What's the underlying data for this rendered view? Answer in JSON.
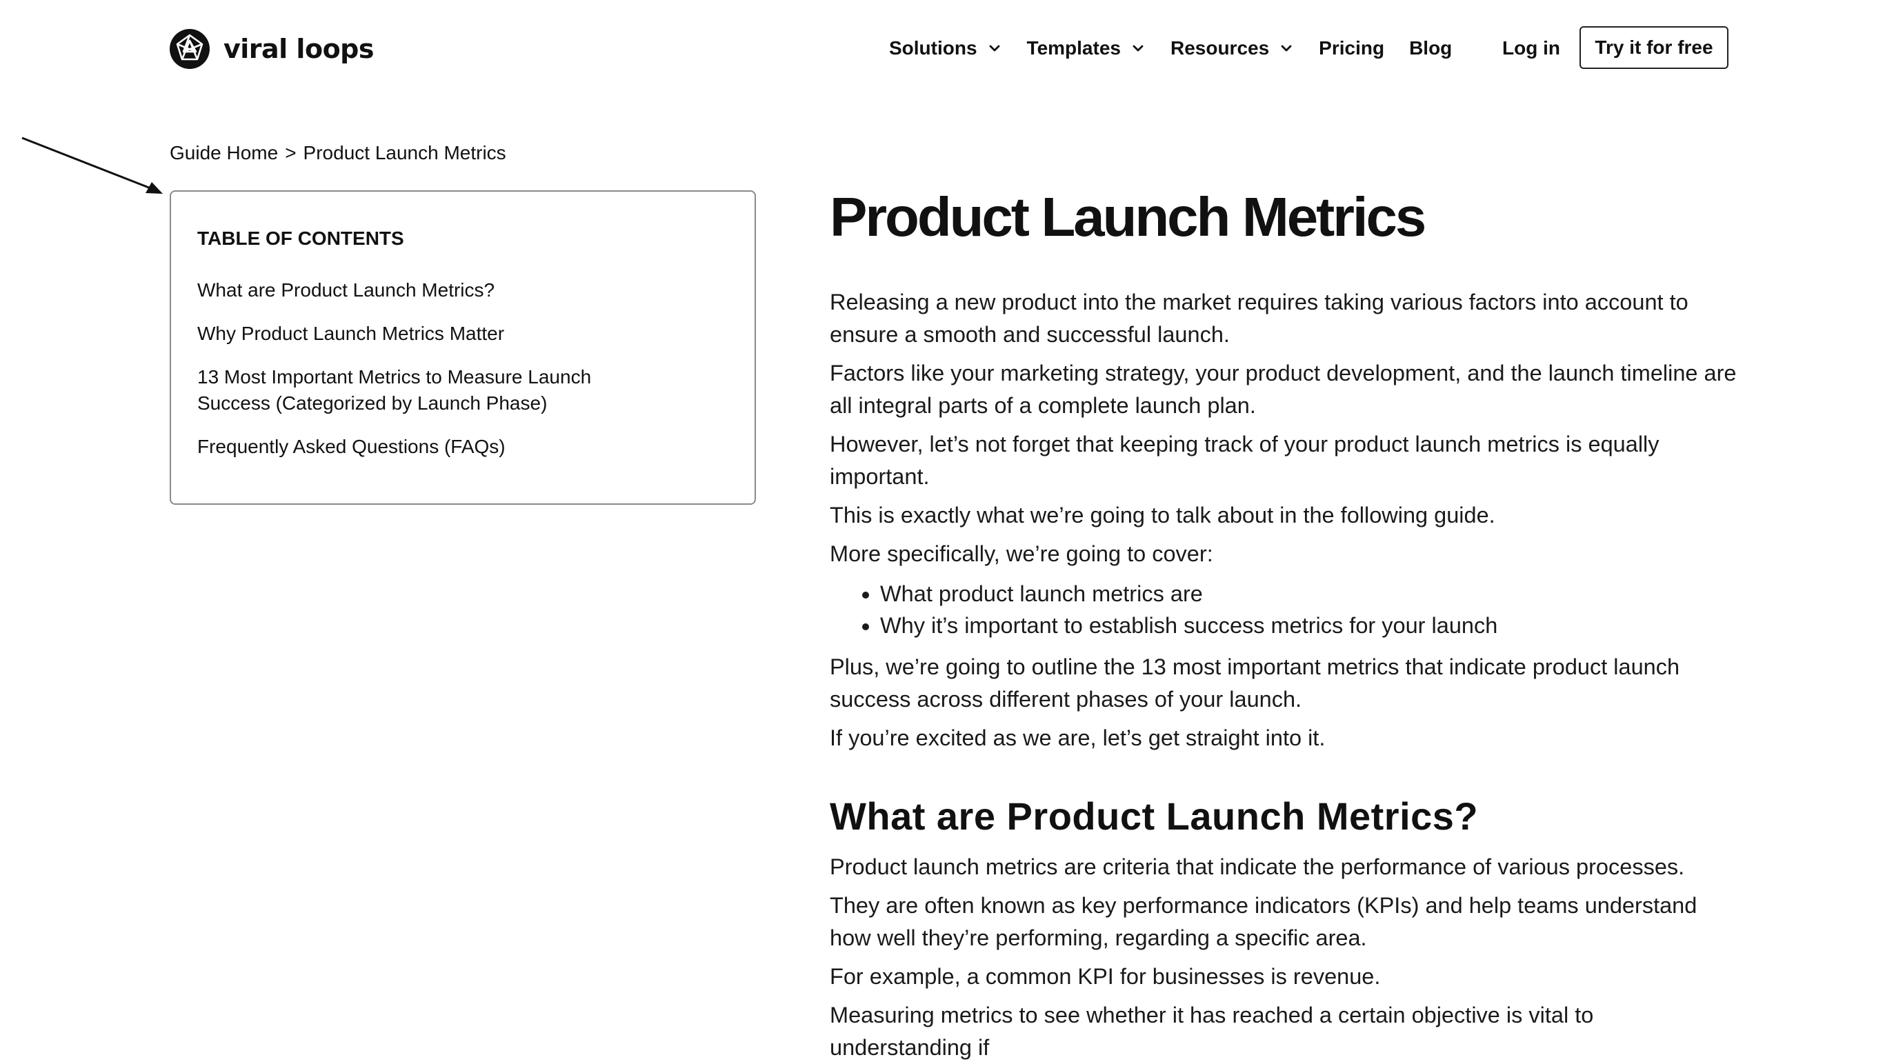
{
  "brand": {
    "name": "viral loops"
  },
  "nav": {
    "items": [
      {
        "label": "Solutions",
        "dropdown": true
      },
      {
        "label": "Templates",
        "dropdown": true
      },
      {
        "label": "Resources",
        "dropdown": true
      },
      {
        "label": "Pricing",
        "dropdown": false
      },
      {
        "label": "Blog",
        "dropdown": false
      }
    ],
    "login": "Log in",
    "cta": "Try it for free"
  },
  "breadcrumb": {
    "home": "Guide Home",
    "separator": ">",
    "current": "Product Launch Metrics"
  },
  "toc": {
    "title": "TABLE OF CONTENTS",
    "items": [
      "What are Product Launch Metrics?",
      "Why Product Launch Metrics Matter",
      "13 Most Important Metrics to Measure Launch Success (Categorized by Launch Phase)",
      "Frequently Asked Questions (FAQs)"
    ]
  },
  "article": {
    "title": "Product Launch Metrics",
    "intro": [
      "Releasing a new product into the market requires taking various factors into account to ensure a smooth and successful launch.",
      "Factors like your marketing strategy, your product development, and the launch timeline are all integral parts of a complete launch plan.",
      "However, let’s not forget that keeping track of your product launch metrics is equally important.",
      "This is exactly what we’re going to talk about in the following guide.",
      "More specifically, we’re going to cover:"
    ],
    "bullets": [
      "What product launch metrics are",
      "Why it’s important to establish success metrics for your launch"
    ],
    "outro": [
      "Plus, we’re going to outline the 13 most important metrics that indicate product launch success across different phases of your launch.",
      "If you’re excited as we are, let’s get straight into it."
    ],
    "section1": {
      "heading": "What are Product Launch Metrics?",
      "paragraphs": [
        "Product launch metrics are criteria that indicate the performance of various processes.",
        "They are often known as key performance indicators (KPIs) and help teams understand how well they’re performing, regarding a specific area.",
        "For example, a common KPI for businesses is revenue.",
        "Measuring metrics to see whether it has reached a certain objective is vital to understanding if"
      ]
    }
  }
}
